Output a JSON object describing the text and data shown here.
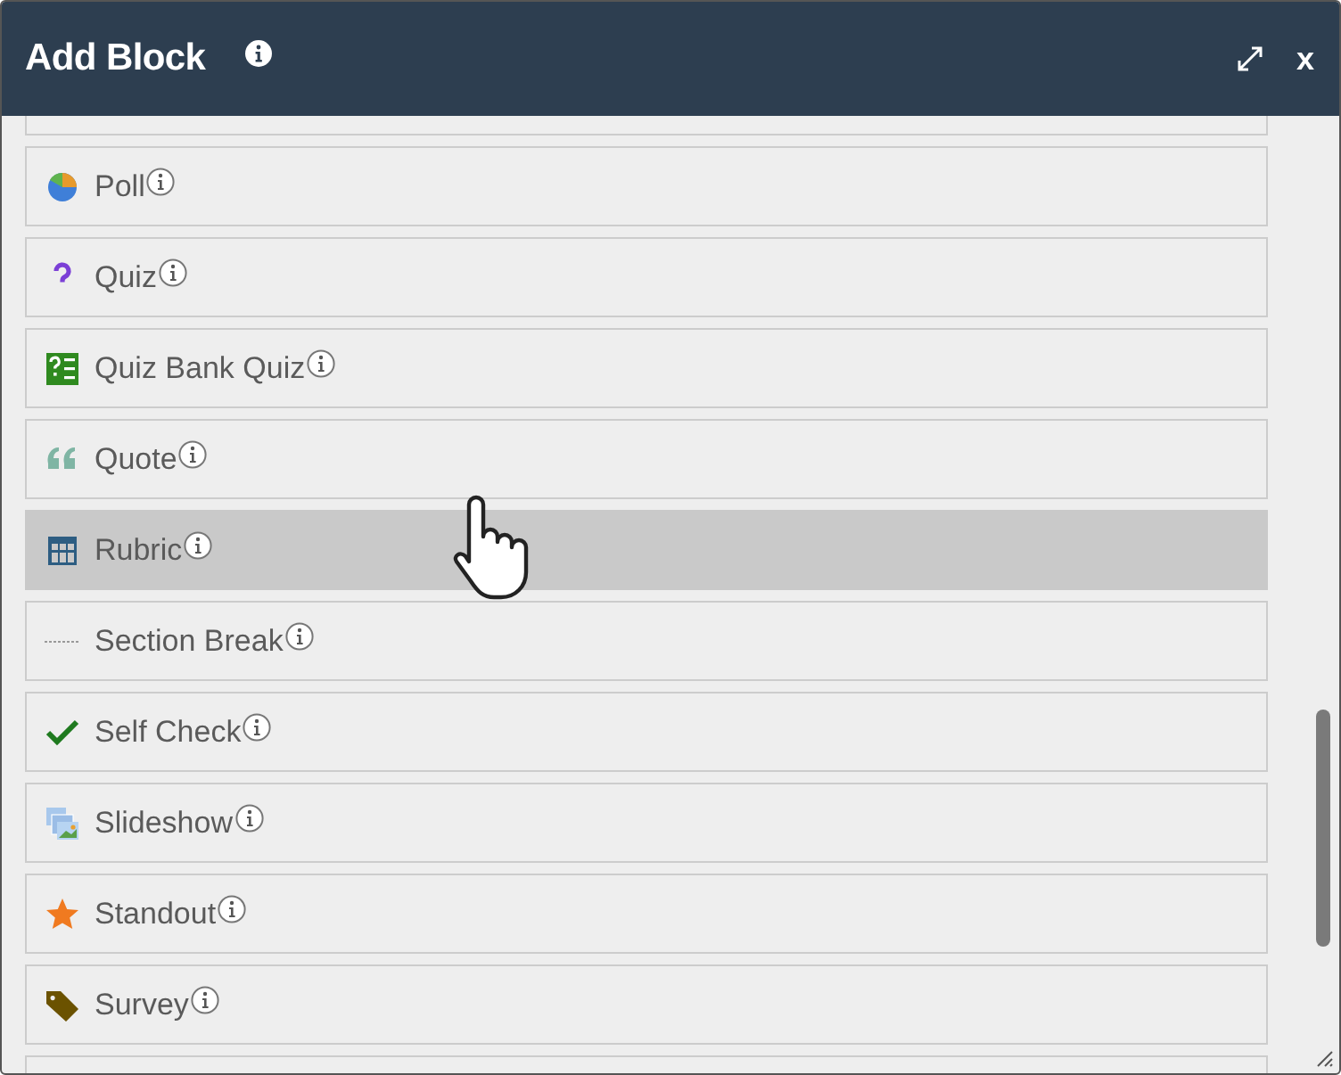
{
  "window": {
    "title": "Add Block",
    "close": "x"
  },
  "blocks": [
    {
      "label": "Poll",
      "kind": "poll",
      "selected": false
    },
    {
      "label": "Quiz",
      "kind": "quiz",
      "selected": false
    },
    {
      "label": "Quiz Bank Quiz",
      "kind": "quizbank",
      "selected": false
    },
    {
      "label": "Quote",
      "kind": "quote",
      "selected": false
    },
    {
      "label": "Rubric",
      "kind": "rubric",
      "selected": true
    },
    {
      "label": "Section Break",
      "kind": "sectionbreak",
      "selected": false
    },
    {
      "label": "Self Check",
      "kind": "check",
      "selected": false
    },
    {
      "label": "Slideshow",
      "kind": "slideshow",
      "selected": false
    },
    {
      "label": "Standout",
      "kind": "star",
      "selected": false
    },
    {
      "label": "Survey",
      "kind": "tag",
      "selected": false
    }
  ]
}
